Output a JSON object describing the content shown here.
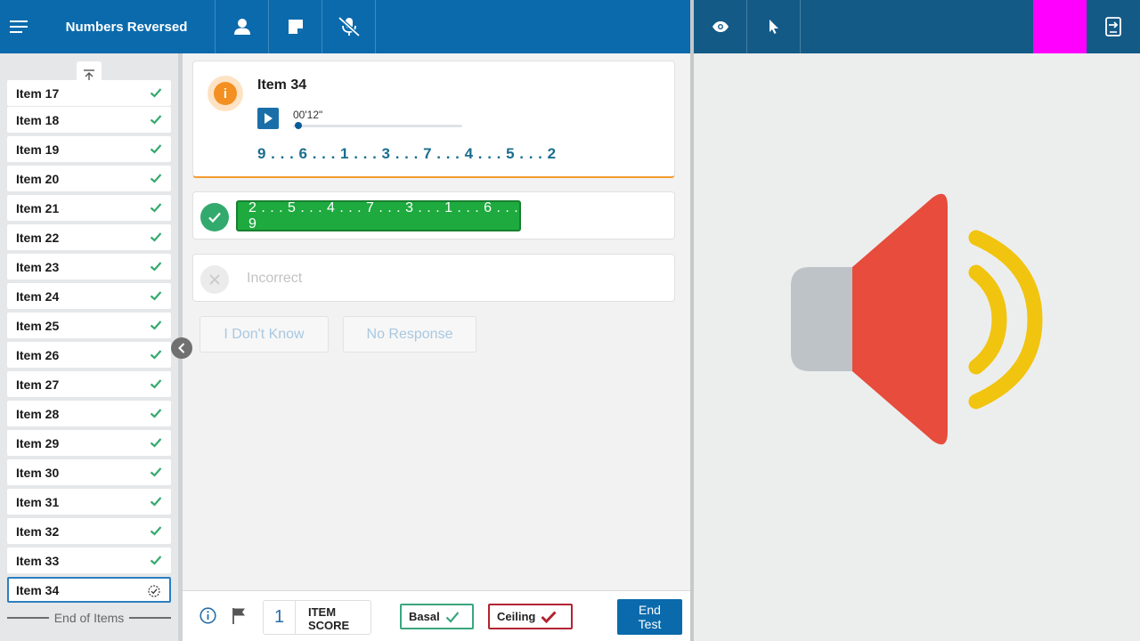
{
  "header": {
    "title": "Numbers Reversed",
    "icons": [
      "menu-icon",
      "person-icon",
      "note-icon",
      "mic-off-icon"
    ],
    "right_icons": [
      "eye-icon",
      "pointer-icon",
      "exit-icon"
    ],
    "magenta_color": "#ff00ff"
  },
  "sidebar": {
    "partial_item": "Item 17",
    "items": [
      {
        "label": "Item 18",
        "status": "done"
      },
      {
        "label": "Item 19",
        "status": "done"
      },
      {
        "label": "Item 20",
        "status": "done"
      },
      {
        "label": "Item 21",
        "status": "done"
      },
      {
        "label": "Item 22",
        "status": "done"
      },
      {
        "label": "Item 23",
        "status": "done"
      },
      {
        "label": "Item 24",
        "status": "done"
      },
      {
        "label": "Item 25",
        "status": "done"
      },
      {
        "label": "Item 26",
        "status": "done"
      },
      {
        "label": "Item 27",
        "status": "done"
      },
      {
        "label": "Item 28",
        "status": "done"
      },
      {
        "label": "Item 29",
        "status": "done"
      },
      {
        "label": "Item 30",
        "status": "done"
      },
      {
        "label": "Item 31",
        "status": "done"
      },
      {
        "label": "Item 32",
        "status": "done"
      },
      {
        "label": "Item 33",
        "status": "done"
      },
      {
        "label": "Item 34",
        "status": "current"
      }
    ],
    "end_label": "End of Items"
  },
  "question": {
    "title": "Item 34",
    "time": "00'12\"",
    "progress": 0.03,
    "sequence": "9 . . . 6 . . . 1 . . . 3 . . . 7 . . . 4 . . . 5 . . . 2"
  },
  "responses": {
    "correct_answer": "2 . . . 5 . . . 4 . . . 7 . . . 3 . . . 1 . . . 6 . . . 9",
    "incorrect_label": "Incorrect",
    "dont_know_label": "I Don't Know",
    "no_response_label": "No Response"
  },
  "footer": {
    "item_score": "1",
    "item_score_label": "ITEM SCORE",
    "basal_label": "Basal",
    "ceiling_label": "Ceiling",
    "end_test_label": "End Test"
  },
  "colors": {
    "primary": "#0a6aac",
    "correct": "#1eaa3f",
    "check": "#33aa6d",
    "ceiling": "#b12431",
    "speaker_red": "#e74c3c",
    "speaker_grey": "#bdc3c7",
    "speaker_yellow": "#f1c40f"
  }
}
